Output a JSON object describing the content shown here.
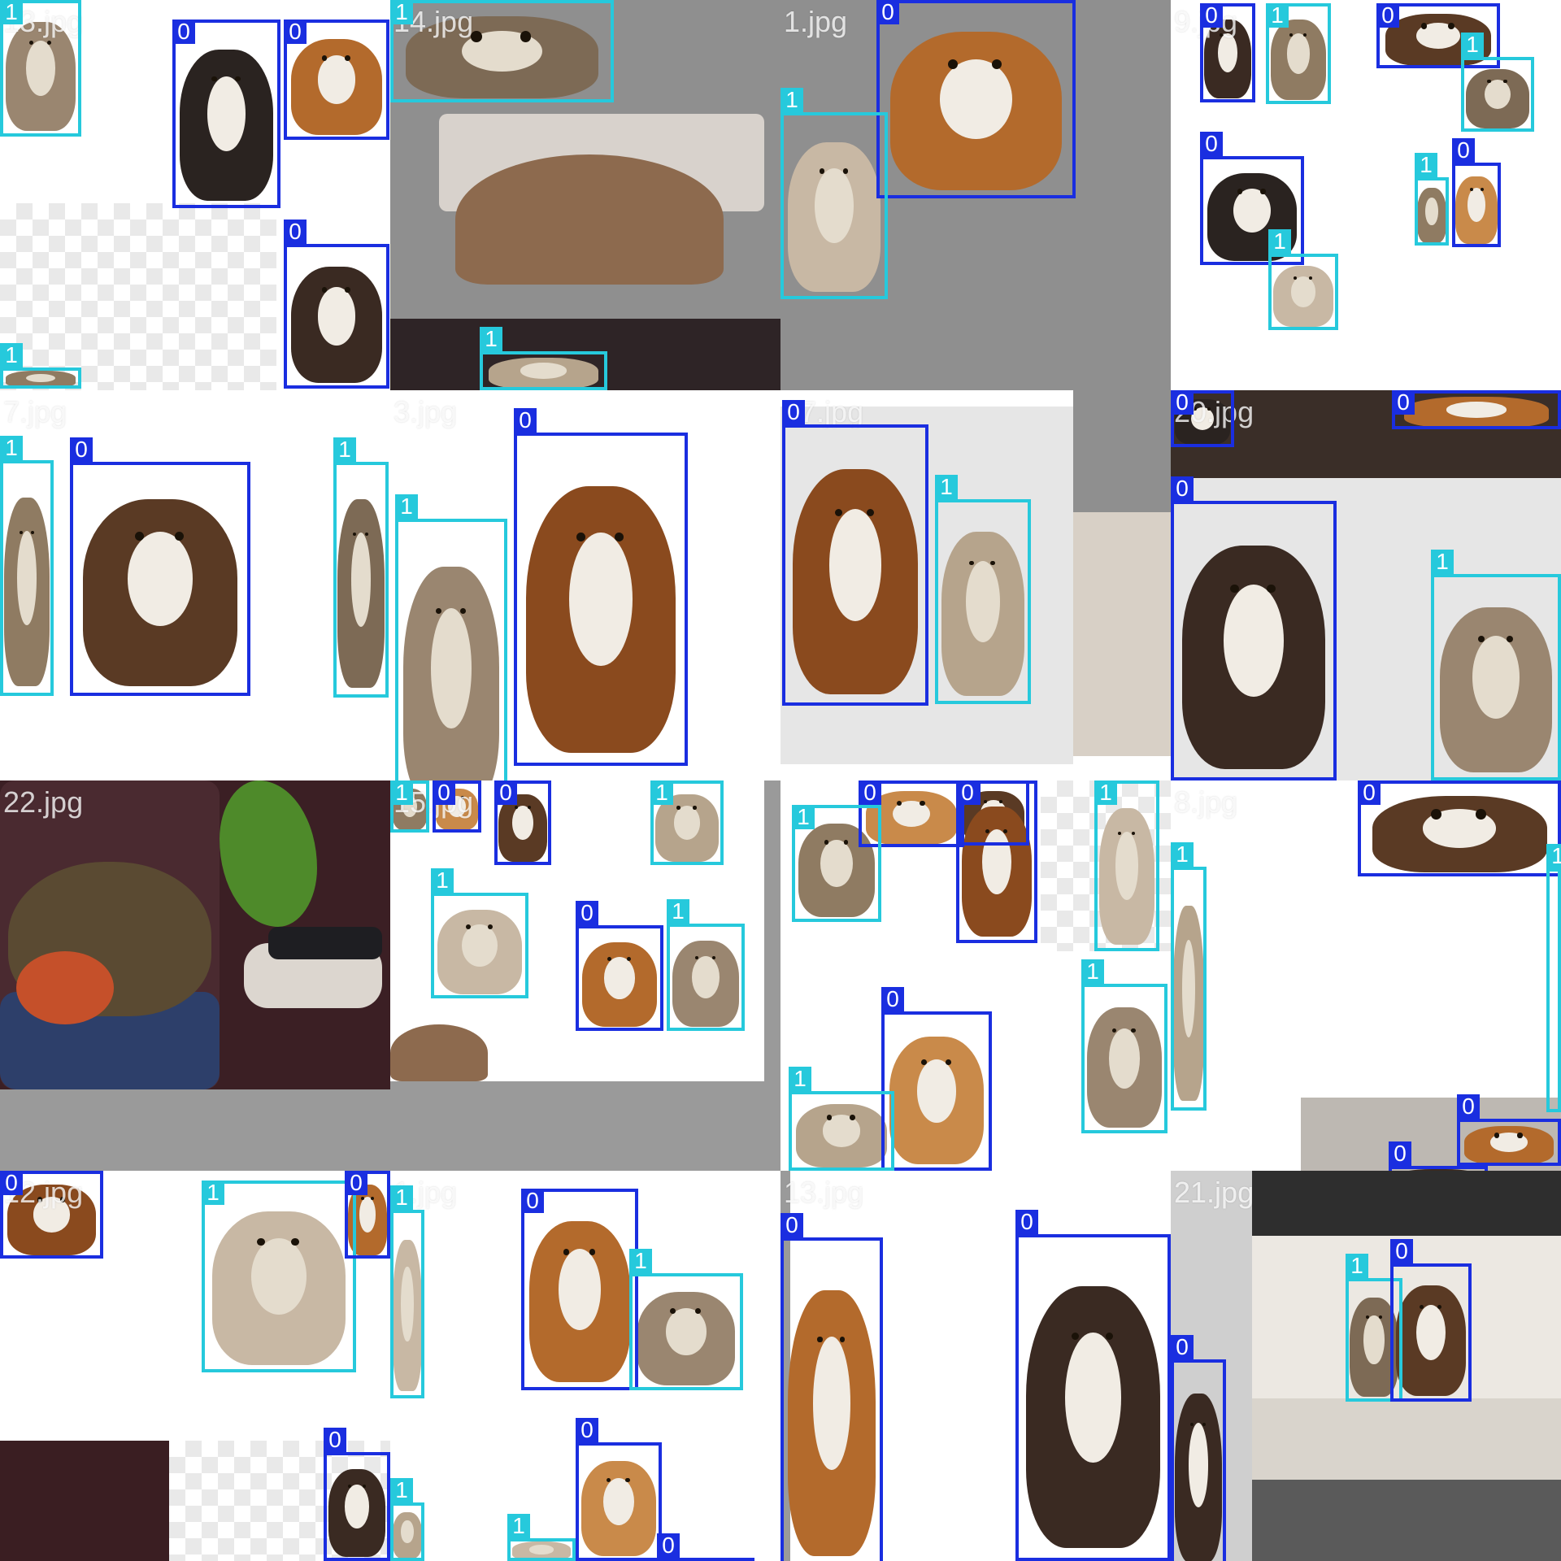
{
  "palette": {
    "class0": "#1a2ee0",
    "class1": "#26c9dc",
    "pad": "#9a9a9a",
    "white": "#ffffff",
    "sofa": "#3b1f24",
    "wall": "#e6e6e6",
    "floor": "#dcdcdc"
  },
  "tiles": [
    {
      "id": "r0c0",
      "filename": "13.jpg",
      "scene": "white",
      "boxes": [
        {
          "cls": "1"
        },
        {
          "cls": "0"
        },
        {
          "cls": "0"
        },
        {
          "cls": "0"
        },
        {
          "cls": "1"
        }
      ]
    },
    {
      "id": "r0c1",
      "filename": "14.jpg",
      "scene": "grey",
      "boxes": [
        {
          "cls": "1"
        },
        {
          "cls": "1"
        }
      ]
    },
    {
      "id": "r0c2",
      "filename": "1.jpg",
      "scene": "grey",
      "boxes": [
        {
          "cls": "0"
        },
        {
          "cls": "1"
        }
      ]
    },
    {
      "id": "r0c3",
      "filename": "9.jpg",
      "scene": "white",
      "boxes": [
        {
          "cls": "0"
        },
        {
          "cls": "1"
        },
        {
          "cls": "0"
        },
        {
          "cls": "1"
        },
        {
          "cls": "0"
        },
        {
          "cls": "1"
        },
        {
          "cls": "1"
        },
        {
          "cls": "0"
        }
      ]
    },
    {
      "id": "r1c0",
      "filename": "7.jpg",
      "scene": "white",
      "boxes": [
        {
          "cls": "1"
        },
        {
          "cls": "0"
        },
        {
          "cls": "1"
        }
      ]
    },
    {
      "id": "r1c1",
      "filename": "3.jpg",
      "scene": "white",
      "boxes": [
        {
          "cls": "1"
        },
        {
          "cls": "0"
        }
      ]
    },
    {
      "id": "r1c2",
      "filename": "07.jpg",
      "scene": "white",
      "boxes": [
        {
          "cls": "0"
        },
        {
          "cls": "1"
        }
      ]
    },
    {
      "id": "r1c3",
      "filename": "20.jpg",
      "scene": "white",
      "boxes": [
        {
          "cls": "0"
        },
        {
          "cls": "0"
        },
        {
          "cls": "0"
        },
        {
          "cls": "1"
        }
      ]
    },
    {
      "id": "r2c0",
      "filename": "22.jpg",
      "scene": "sofa",
      "boxes": []
    },
    {
      "id": "r2c1",
      "filename": "15.jpg",
      "scene": "white",
      "boxes": [
        {
          "cls": "1"
        },
        {
          "cls": "0"
        },
        {
          "cls": "0"
        },
        {
          "cls": "1"
        },
        {
          "cls": "1"
        },
        {
          "cls": "0"
        },
        {
          "cls": "1"
        }
      ]
    },
    {
      "id": "r2c2",
      "filename": "",
      "scene": "white",
      "boxes": [
        {
          "cls": "0"
        },
        {
          "cls": "0"
        },
        {
          "cls": "0"
        },
        {
          "cls": "1"
        },
        {
          "cls": "1"
        },
        {
          "cls": "1"
        },
        {
          "cls": "0"
        },
        {
          "cls": "1"
        }
      ]
    },
    {
      "id": "r2c3",
      "filename": "8.jpg",
      "scene": "white",
      "boxes": [
        {
          "cls": "0"
        },
        {
          "cls": "1"
        },
        {
          "cls": "1"
        },
        {
          "cls": "0"
        },
        {
          "cls": "0"
        }
      ]
    },
    {
      "id": "r3c0",
      "filename": "12.jpg",
      "scene": "white",
      "boxes": [
        {
          "cls": "0"
        },
        {
          "cls": "1"
        },
        {
          "cls": "0"
        },
        {
          "cls": "0"
        }
      ]
    },
    {
      "id": "r3c1",
      "filename": "1.jpg",
      "scene": "white",
      "boxes": [
        {
          "cls": "1"
        },
        {
          "cls": "0"
        },
        {
          "cls": "1"
        },
        {
          "cls": "0"
        },
        {
          "cls": "1"
        },
        {
          "cls": "1"
        },
        {
          "cls": "0"
        }
      ]
    },
    {
      "id": "r3c2",
      "filename": "13.jpg",
      "scene": "white",
      "boxes": [
        {
          "cls": "0"
        },
        {
          "cls": "0"
        }
      ]
    },
    {
      "id": "r3c3",
      "filename": "21.jpg",
      "scene": "room",
      "boxes": [
        {
          "cls": "0"
        },
        {
          "cls": "1"
        },
        {
          "cls": "0"
        }
      ]
    }
  ]
}
